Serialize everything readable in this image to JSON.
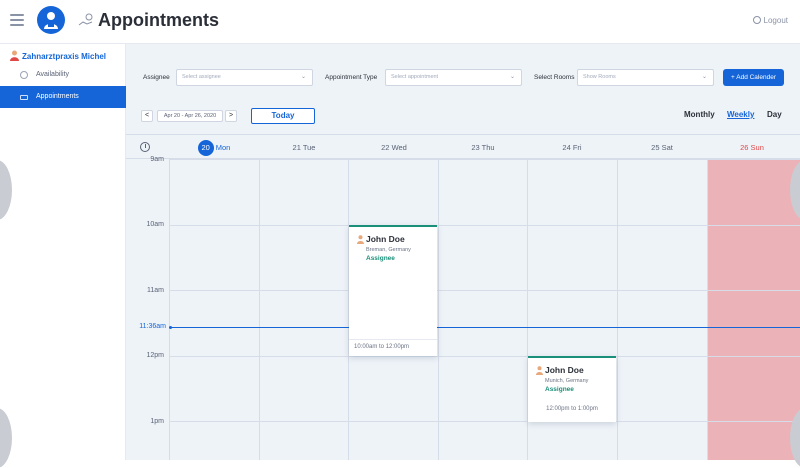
{
  "header": {
    "title": "Appointments",
    "logout_label": "Logout"
  },
  "sidebar": {
    "clinic_name": "Zahnarztpraxis Michel",
    "items": [
      {
        "label": "Availability",
        "icon": "gear-icon",
        "active": false
      },
      {
        "label": "Appointments",
        "icon": "appointments-icon",
        "active": true
      }
    ]
  },
  "filters": {
    "assignee_label": "Assignee",
    "assignee_placeholder": "Select assignee",
    "appt_type_label": "Appointment Type",
    "appt_type_placeholder": "Select appointment",
    "rooms_label": "Select Rooms",
    "rooms_placeholder": "Show Rooms",
    "add_button": "+ Add Calender"
  },
  "toolbar": {
    "prev": "<",
    "next": ">",
    "date_range": "Apr 20 - Apr 26, 2020",
    "today": "Today",
    "views": [
      "Monthly",
      "Weekly",
      "Day"
    ],
    "active_view": "Weekly"
  },
  "calendar": {
    "days": [
      {
        "num": "20",
        "name": "Mon",
        "today": true
      },
      {
        "label": "21 Tue"
      },
      {
        "label": "22 Wed"
      },
      {
        "label": "23 Thu"
      },
      {
        "label": "24 Fri"
      },
      {
        "label": "25 Sat"
      },
      {
        "label": "26 Sun",
        "weekend": true
      }
    ],
    "times": [
      "9am",
      "10am",
      "11am",
      "12pm",
      "1pm"
    ],
    "now_label": "11:36am",
    "appointments": [
      {
        "name": "John Doe",
        "location": "Breman, Germany",
        "role": "Assignee",
        "time": "10:00am to 12:00pm",
        "day": "22 Wed"
      },
      {
        "name": "John Doe",
        "location": "Munich, Germany",
        "role": "Assignee",
        "time": "12:00pm to 1:00pm",
        "day": "24 Fri"
      }
    ]
  },
  "colors": {
    "primary": "#1565d8",
    "accent": "#1a8f7a",
    "weekend": "#ebb3b8",
    "sunday_text": "#e04848",
    "background": "#eef3f8"
  }
}
